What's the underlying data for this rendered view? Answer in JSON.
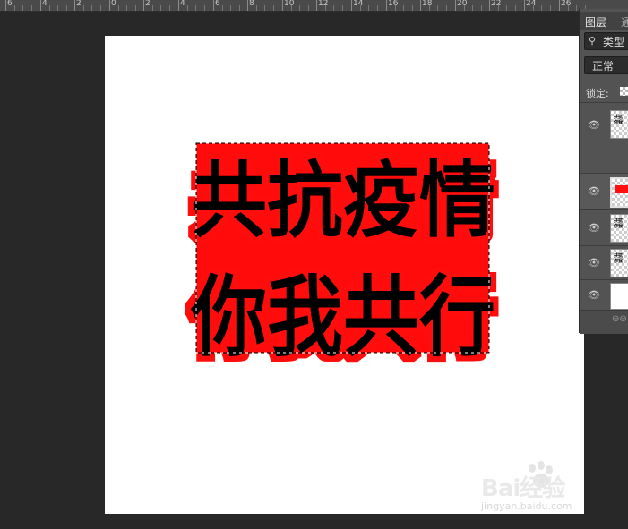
{
  "ruler": {
    "labels": [
      "6",
      "4",
      "2",
      "0",
      "2",
      "4",
      "6",
      "8",
      "10",
      "12",
      "14",
      "16",
      "18",
      "20",
      "22",
      "24",
      "26"
    ]
  },
  "artwork": {
    "line1": "共抗疫情",
    "line2": "你我共行",
    "fill_color": "#ff0b0b",
    "text_color": "#000000"
  },
  "watermark": {
    "main": "Bai经验",
    "sub": "jingyan.baidu.com"
  },
  "layers_panel": {
    "tab_layers": "图层",
    "tab_channels": "通",
    "filter_label": "类型",
    "filter_icon": "search-icon",
    "blend_mode": "正常",
    "lock_label": "锁定:",
    "layers": [
      {
        "name": "text-layer",
        "visible": true,
        "selected": false
      },
      {
        "name": "red-shape-layer",
        "visible": true,
        "selected": true
      },
      {
        "name": "text-copy-layer",
        "visible": true,
        "selected": false
      },
      {
        "name": "text-copy-2-layer",
        "visible": true,
        "selected": false
      },
      {
        "name": "background-layer",
        "visible": true,
        "selected": false
      }
    ],
    "eye_icon": "eye-icon",
    "link_icon": "link-icon"
  }
}
